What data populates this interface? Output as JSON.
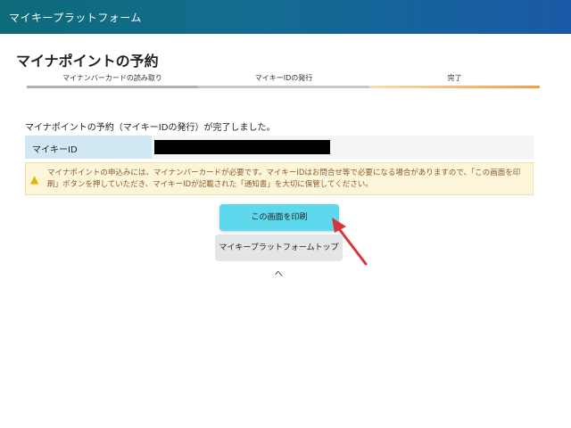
{
  "header": {
    "app_title": "マイキープラットフォーム"
  },
  "page": {
    "title": "マイナポイントの予約"
  },
  "steps": [
    {
      "label": "マイナンバーカードの読み取り"
    },
    {
      "label": "マイキーIDの発行"
    },
    {
      "label": "完了"
    }
  ],
  "result": {
    "message": "マイナポイントの予約（マイキーIDの発行）が完了しました。",
    "id_label": "マイキーID"
  },
  "notice": {
    "icon": "warning-icon",
    "text": "マイナポイントの申込みには、マイナンバーカードが必要です。マイキーIDはお問合せ等で必要になる場合がありますので、「この画面を印刷」ボタンを押していただき、マイキーIDが記載された「通知書」を大切に保管してください。"
  },
  "actions": {
    "print_label": "この画面を印刷",
    "top_label": "マイキープラットフォームトップへ"
  },
  "colors": {
    "header_gradient_start": "#0d6b7a",
    "header_gradient_end": "#1a5aa8",
    "print_button": "#5ed8ec",
    "annotation_arrow": "#d9343a"
  }
}
